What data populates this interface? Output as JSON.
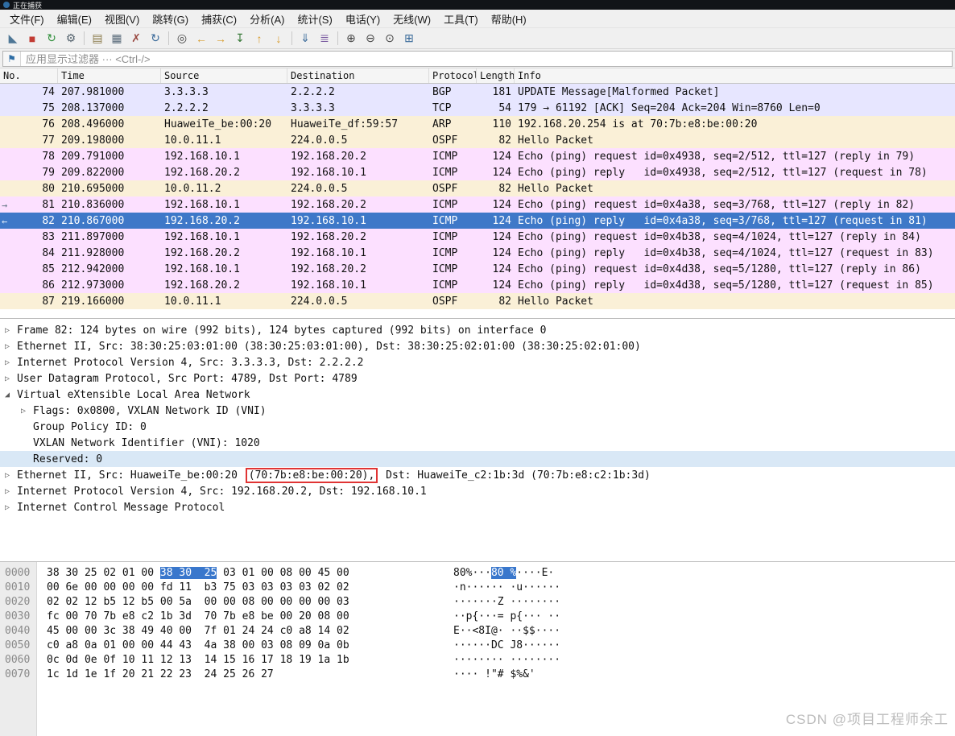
{
  "window": {
    "title": "正在捕获"
  },
  "menu": {
    "items": [
      {
        "id": "file",
        "label": "文件(F)"
      },
      {
        "id": "edit",
        "label": "编辑(E)"
      },
      {
        "id": "view",
        "label": "视图(V)"
      },
      {
        "id": "go",
        "label": "跳转(G)"
      },
      {
        "id": "capture",
        "label": "捕获(C)"
      },
      {
        "id": "analyze",
        "label": "分析(A)"
      },
      {
        "id": "statistics",
        "label": "统计(S)"
      },
      {
        "id": "telephony",
        "label": "电话(Y)"
      },
      {
        "id": "wireless",
        "label": "无线(W)"
      },
      {
        "id": "tools",
        "label": "工具(T)"
      },
      {
        "id": "help",
        "label": "帮助(H)"
      }
    ]
  },
  "toolbar": {
    "items": [
      {
        "name": "start-capture-icon",
        "glyph": "◣",
        "color": "#4f7796"
      },
      {
        "name": "stop-capture-icon",
        "glyph": "■",
        "color": "#c23b33"
      },
      {
        "name": "restart-capture-icon",
        "glyph": "↻",
        "color": "#2f8f3a"
      },
      {
        "name": "capture-options-icon",
        "glyph": "⚙",
        "color": "#55636e"
      },
      {
        "sep": true
      },
      {
        "name": "open-file-icon",
        "glyph": "▤",
        "color": "#8a7a4a"
      },
      {
        "name": "save-file-icon",
        "glyph": "▦",
        "color": "#5a6b7a"
      },
      {
        "name": "close-file-icon",
        "glyph": "✗",
        "color": "#9a4a42"
      },
      {
        "name": "reload-icon",
        "glyph": "↻",
        "color": "#3a6a9a"
      },
      {
        "sep": true
      },
      {
        "name": "find-packet-icon",
        "glyph": "◎",
        "color": "#444444"
      },
      {
        "name": "go-back-icon",
        "glyph": "←",
        "color": "#d79b2a"
      },
      {
        "name": "go-forward-icon",
        "glyph": "→",
        "color": "#d79b2a"
      },
      {
        "name": "go-to-packet-icon",
        "glyph": "↧",
        "color": "#3a7a3a"
      },
      {
        "name": "go-first-icon",
        "glyph": "↑",
        "color": "#d79b2a"
      },
      {
        "name": "go-last-icon",
        "glyph": "↓",
        "color": "#d79b2a"
      },
      {
        "sep": true
      },
      {
        "name": "auto-scroll-icon",
        "glyph": "⇓",
        "color": "#3a6a9a"
      },
      {
        "name": "colorize-icon",
        "glyph": "≣",
        "color": "#7a5aa0"
      },
      {
        "sep": true
      },
      {
        "name": "zoom-in-icon",
        "glyph": "⊕",
        "color": "#444444"
      },
      {
        "name": "zoom-out-icon",
        "glyph": "⊖",
        "color": "#444444"
      },
      {
        "name": "zoom-reset-icon",
        "glyph": "⊙",
        "color": "#444444"
      },
      {
        "name": "resize-columns-icon",
        "glyph": "⊞",
        "color": "#3a6a9a"
      }
    ]
  },
  "filter": {
    "placeholder": "应用显示过滤器 ··· <Ctrl-/>"
  },
  "colors": {
    "lavender": "#e7e6ff",
    "cream": "#faf0d7",
    "pink": "#fce0ff",
    "selected_row": "#3e78c8",
    "detail_selected": "#d9e8f6",
    "hex_highlight": "#3977cc",
    "accent_red": "#e03434"
  },
  "packet_list": {
    "columns": [
      {
        "id": "no",
        "label": "No."
      },
      {
        "id": "time",
        "label": "Time"
      },
      {
        "id": "source",
        "label": "Source"
      },
      {
        "id": "destination",
        "label": "Destination"
      },
      {
        "id": "protocol",
        "label": "Protocol"
      },
      {
        "id": "length",
        "label": "Length"
      },
      {
        "id": "info",
        "label": "Info"
      }
    ],
    "rows": [
      {
        "no": "74",
        "time": "207.981000",
        "source": "3.3.3.3",
        "destination": "2.2.2.2",
        "protocol": "BGP",
        "length": "181",
        "info": "UPDATE Message[Malformed Packet]",
        "color": "lavender"
      },
      {
        "no": "75",
        "time": "208.137000",
        "source": "2.2.2.2",
        "destination": "3.3.3.3",
        "protocol": "TCP",
        "length": "54",
        "info": "179 → 61192 [ACK] Seq=204 Ack=204 Win=8760 Len=0",
        "color": "lavender"
      },
      {
        "no": "76",
        "time": "208.496000",
        "source": "HuaweiTe_be:00:20",
        "destination": "HuaweiTe_df:59:57",
        "protocol": "ARP",
        "length": "110",
        "info": "192.168.20.254 is at 70:7b:e8:be:00:20",
        "color": "cream"
      },
      {
        "no": "77",
        "time": "209.198000",
        "source": "10.0.11.1",
        "destination": "224.0.0.5",
        "protocol": "OSPF",
        "length": "82",
        "info": "Hello Packet",
        "color": "cream"
      },
      {
        "no": "78",
        "time": "209.791000",
        "source": "192.168.10.1",
        "destination": "192.168.20.2",
        "protocol": "ICMP",
        "length": "124",
        "info": "Echo (ping) request id=0x4938, seq=2/512, ttl=127 (reply in 79)",
        "color": "pink"
      },
      {
        "no": "79",
        "time": "209.822000",
        "source": "192.168.20.2",
        "destination": "192.168.10.1",
        "protocol": "ICMP",
        "length": "124",
        "info": "Echo (ping) reply   id=0x4938, seq=2/512, ttl=127 (request in 78)",
        "color": "pink"
      },
      {
        "no": "80",
        "time": "210.695000",
        "source": "10.0.11.2",
        "destination": "224.0.0.5",
        "protocol": "OSPF",
        "length": "82",
        "info": "Hello Packet",
        "color": "cream"
      },
      {
        "no": "81",
        "time": "210.836000",
        "source": "192.168.10.1",
        "destination": "192.168.20.2",
        "protocol": "ICMP",
        "length": "124",
        "info": "Echo (ping) request id=0x4a38, seq=3/768, ttl=127 (reply in 82)",
        "color": "pink",
        "marker": "→"
      },
      {
        "no": "82",
        "time": "210.867000",
        "source": "192.168.20.2",
        "destination": "192.168.10.1",
        "protocol": "ICMP",
        "length": "124",
        "info": "Echo (ping) reply   id=0x4a38, seq=3/768, ttl=127 (request in 81)",
        "selected": true,
        "marker": "←"
      },
      {
        "no": "83",
        "time": "211.897000",
        "source": "192.168.10.1",
        "destination": "192.168.20.2",
        "protocol": "ICMP",
        "length": "124",
        "info": "Echo (ping) request id=0x4b38, seq=4/1024, ttl=127 (reply in 84)",
        "color": "pink"
      },
      {
        "no": "84",
        "time": "211.928000",
        "source": "192.168.20.2",
        "destination": "192.168.10.1",
        "protocol": "ICMP",
        "length": "124",
        "info": "Echo (ping) reply   id=0x4b38, seq=4/1024, ttl=127 (request in 83)",
        "color": "pink"
      },
      {
        "no": "85",
        "time": "212.942000",
        "source": "192.168.10.1",
        "destination": "192.168.20.2",
        "protocol": "ICMP",
        "length": "124",
        "info": "Echo (ping) request id=0x4d38, seq=5/1280, ttl=127 (reply in 86)",
        "color": "pink"
      },
      {
        "no": "86",
        "time": "212.973000",
        "source": "192.168.20.2",
        "destination": "192.168.10.1",
        "protocol": "ICMP",
        "length": "124",
        "info": "Echo (ping) reply   id=0x4d38, seq=5/1280, ttl=127 (request in 85)",
        "color": "pink"
      },
      {
        "no": "87",
        "time": "219.166000",
        "source": "10.0.11.1",
        "destination": "224.0.0.5",
        "protocol": "OSPF",
        "length": "82",
        "info": "Hello Packet",
        "color": "cream"
      }
    ]
  },
  "details": {
    "rows": [
      {
        "indent": 0,
        "expander": "collapsed",
        "parts": [
          {
            "text": "Frame 82: 124 bytes on wire (992 bits), 124 bytes captured (992 bits) on interface 0"
          }
        ]
      },
      {
        "indent": 0,
        "expander": "collapsed",
        "parts": [
          {
            "text": "Ethernet II, Src: 38:30:25:03:01:00 (38:30:25:03:01:00), Dst: 38:30:25:02:01:00 (38:30:25:02:01:00)"
          }
        ]
      },
      {
        "indent": 0,
        "expander": "collapsed",
        "parts": [
          {
            "text": "Internet Protocol Version 4, Src: 3.3.3.3, Dst: 2.2.2.2"
          }
        ]
      },
      {
        "indent": 0,
        "expander": "collapsed",
        "parts": [
          {
            "text": "User Datagram Protocol, Src Port: 4789, Dst Port: 4789"
          }
        ]
      },
      {
        "indent": 0,
        "expander": "expanded",
        "parts": [
          {
            "text": "Virtual eXtensible Local Area Network"
          }
        ]
      },
      {
        "indent": 1,
        "expander": "collapsed",
        "parts": [
          {
            "text": "Flags: 0x0800, VXLAN Network ID (VNI)"
          }
        ]
      },
      {
        "indent": 1,
        "expander": "none",
        "parts": [
          {
            "text": "Group Policy ID: 0"
          }
        ]
      },
      {
        "indent": 1,
        "expander": "none",
        "parts": [
          {
            "text": "VXLAN Network Identifier (VNI): 1020"
          }
        ]
      },
      {
        "indent": 1,
        "expander": "none",
        "selected": true,
        "parts": [
          {
            "text": "Reserved: 0"
          }
        ]
      },
      {
        "indent": 0,
        "expander": "collapsed",
        "parts": [
          {
            "text": "Ethernet II, Src: HuaweiTe_be:00:20 "
          },
          {
            "text": "(70:7b:e8:be:00:20),",
            "box": true
          },
          {
            "text": " Dst: HuaweiTe_c2:1b:3d (70:7b:e8:c2:1b:3d)"
          }
        ]
      },
      {
        "indent": 0,
        "expander": "collapsed",
        "parts": [
          {
            "text": "Internet Protocol Version 4, Src: 192.168.20.2, Dst: 192.168.10.1"
          }
        ]
      },
      {
        "indent": 0,
        "expander": "collapsed",
        "parts": [
          {
            "text": "Internet Control Message Protocol"
          }
        ]
      }
    ]
  },
  "hex": {
    "rows": [
      {
        "offset": "0000",
        "hex": [
          {
            "t": "38 30 25 02 01 00 "
          },
          {
            "t": "38 30  25",
            "hl": true
          },
          {
            "t": " 03 01 00 08 00 45 00"
          }
        ],
        "ascii": [
          {
            "t": "80%···"
          },
          {
            "t": "80 %",
            "hl": true
          },
          {
            "t": "····E·"
          }
        ]
      },
      {
        "offset": "0010",
        "hex": [
          {
            "t": "00 6e 00 00 00 00 fd 11  b3 75 03 03 03 03 02 02"
          }
        ],
        "ascii": [
          {
            "t": "·n······ ·u······"
          }
        ]
      },
      {
        "offset": "0020",
        "hex": [
          {
            "t": "02 02 12 b5 12 b5 00 5a  00 00 08 00 00 00 00 03"
          }
        ],
        "ascii": [
          {
            "t": "·······Z ········"
          }
        ]
      },
      {
        "offset": "0030",
        "hex": [
          {
            "t": "fc 00 70 7b e8 c2 1b 3d  70 7b e8 be 00 20 08 00"
          }
        ],
        "ascii": [
          {
            "t": "··p{···= p{··· ··"
          }
        ]
      },
      {
        "offset": "0040",
        "hex": [
          {
            "t": "45 00 00 3c 38 49 40 00  7f 01 24 24 c0 a8 14 02"
          }
        ],
        "ascii": [
          {
            "t": "E··<8I@· ··$$····"
          }
        ]
      },
      {
        "offset": "0050",
        "hex": [
          {
            "t": "c0 a8 0a 01 00 00 44 43  4a 38 00 03 08 09 0a 0b"
          }
        ],
        "ascii": [
          {
            "t": "······DC J8······"
          }
        ]
      },
      {
        "offset": "0060",
        "hex": [
          {
            "t": "0c 0d 0e 0f 10 11 12 13  14 15 16 17 18 19 1a 1b"
          }
        ],
        "ascii": [
          {
            "t": "········ ········"
          }
        ]
      },
      {
        "offset": "0070",
        "hex": [
          {
            "t": "1c 1d 1e 1f 20 21 22 23  24 25 26 27"
          }
        ],
        "ascii": [
          {
            "t": "···· !\"# $%&'"
          }
        ]
      }
    ]
  },
  "watermark": "CSDN @项目工程师余工"
}
